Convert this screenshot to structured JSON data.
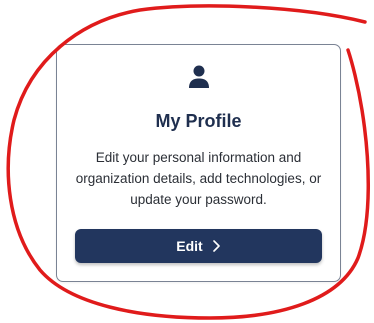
{
  "profile_card": {
    "icon": "user-icon",
    "title": "My Profile",
    "description": "Edit your personal information and organization details, add technologies, or update your password.",
    "edit_button_label": "Edit",
    "edit_button_icon": "chevron-right-icon"
  },
  "colors": {
    "title_text": "#1f2f4f",
    "button_background": "#22365e",
    "button_text": "#ffffff",
    "card_border": "#7a8394",
    "annotation_stroke": "#e01b1b"
  }
}
